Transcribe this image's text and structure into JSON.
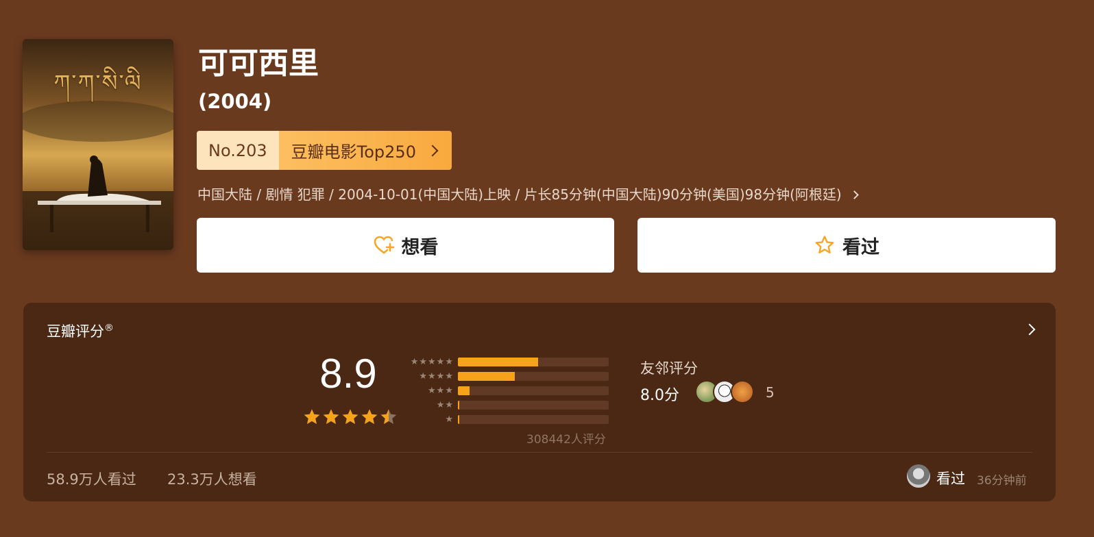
{
  "movie": {
    "title": "可可西里",
    "year": "(2004)",
    "poster_title": "ཀ་ཀ་སི་ལི",
    "rank_no": "No.203",
    "rank_list": "豆瓣电影Top250",
    "meta": "中国大陆 / 剧情 犯罪 / 2004-10-01(中国大陆)上映 / 片长85分钟(中国大陆)90分钟(美国)98分钟(阿根廷)"
  },
  "actions": {
    "wish_label": "想看",
    "seen_label": "看过"
  },
  "rating": {
    "title": "豆瓣评分",
    "title_mark": "®",
    "score": "8.9",
    "star_value": 4.5,
    "distribution": [
      {
        "stars": "★★★★★",
        "fraction": 0.53
      },
      {
        "stars": "★★★★",
        "fraction": 0.375
      },
      {
        "stars": "★★★",
        "fraction": 0.075
      },
      {
        "stars": "★★",
        "fraction": 0.01
      },
      {
        "stars": "★",
        "fraction": 0.004
      }
    ],
    "count_text": "308442人评分",
    "friend_label": "友邻评分",
    "friend_score": "8.0分",
    "friend_count": "5"
  },
  "stats": {
    "seen": "58.9万人看过",
    "wish": "23.3万人想看"
  },
  "my_status": {
    "label": "看过",
    "time": "36分钟前"
  },
  "colors": {
    "background": "#6a3a1f",
    "panel": "#4a2813",
    "accent": "#f7a21b",
    "badge_light": "#fde4bd"
  }
}
